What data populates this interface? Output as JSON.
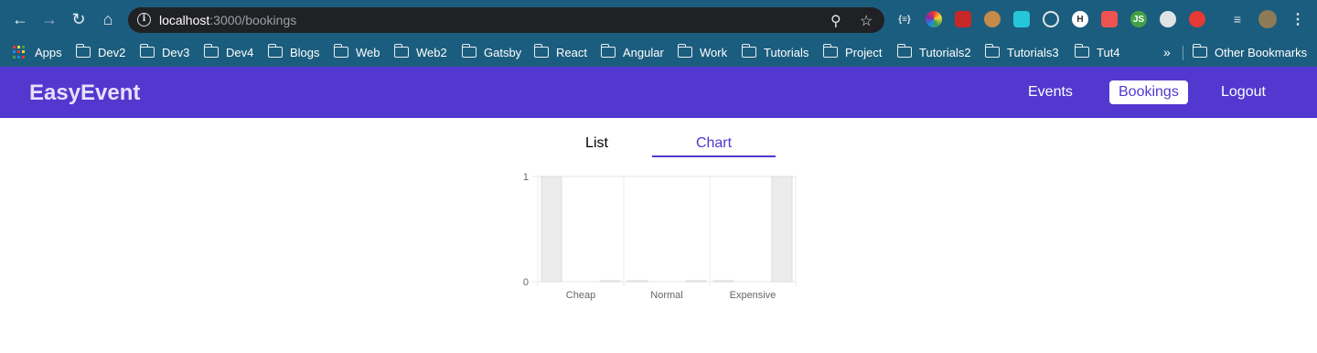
{
  "browser": {
    "url_host": "localhost",
    "url_path": ":3000/bookings",
    "bookmarks": [
      "Apps",
      "Dev2",
      "Dev3",
      "Dev4",
      "Blogs",
      "Web",
      "Web2",
      "Gatsby",
      "React",
      "Angular",
      "Work",
      "Tutorials",
      "Project",
      "Tutorials2",
      "Tutorials3",
      "Tut4"
    ],
    "more_label": "»",
    "other_bookmarks": "Other Bookmarks"
  },
  "navbar": {
    "logo": "EasyEvent",
    "links": [
      "Events",
      "Bookings",
      "Logout"
    ],
    "active": "Bookings"
  },
  "tabs": {
    "items": [
      "List",
      "Chart"
    ],
    "active": "Chart"
  },
  "colors": {
    "brand": "#5238cf",
    "chrome": "#1b5d7e",
    "bar_fill": "#ececec",
    "bar_stroke": "#dcdcdc"
  },
  "chart_data": {
    "type": "bar",
    "categories": [
      "Cheap",
      "Normal",
      "Expensive"
    ],
    "series": [
      {
        "values": [
          1,
          0,
          0
        ]
      },
      {
        "values": [
          0,
          0,
          1
        ]
      }
    ],
    "yticks": [
      "0",
      "1"
    ],
    "ylim": [
      0,
      1
    ],
    "grid": true,
    "legend": "none"
  }
}
